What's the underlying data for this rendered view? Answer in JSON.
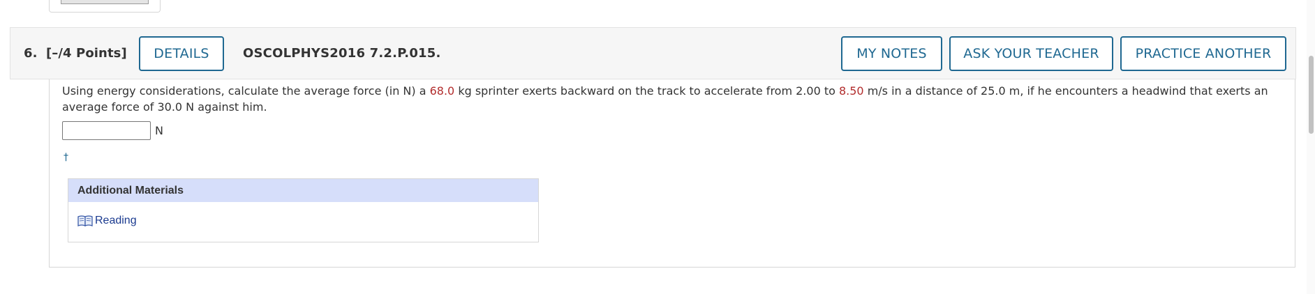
{
  "question": {
    "number_label": "6.",
    "points_label": "[–/4 Points]",
    "code": "OSCOLPHYS2016 7.2.P.015.",
    "buttons": {
      "details": "DETAILS",
      "my_notes": "MY NOTES",
      "ask_teacher": "ASK YOUR TEACHER",
      "practice_another": "PRACTICE ANOTHER"
    },
    "text_parts": [
      "Using energy considerations, calculate the average force (in N) a ",
      "68.0",
      " kg sprinter exerts backward on the track to accelerate from 2.00 to ",
      "8.50",
      " m/s in a distance of 25.0 m, if he encounters a headwind that exerts an average force of 30.0 N against him."
    ],
    "answer": {
      "value": "",
      "unit": "N"
    },
    "footnote_marker": "†"
  },
  "additional_materials": {
    "header": "Additional Materials",
    "items": [
      {
        "label": "Reading",
        "icon": "book-icon"
      }
    ]
  },
  "colors": {
    "accent": "#1f6891",
    "highlight_value": "#b22d2d",
    "materials_header_bg": "#d6defa",
    "link": "#1a3a8f"
  }
}
